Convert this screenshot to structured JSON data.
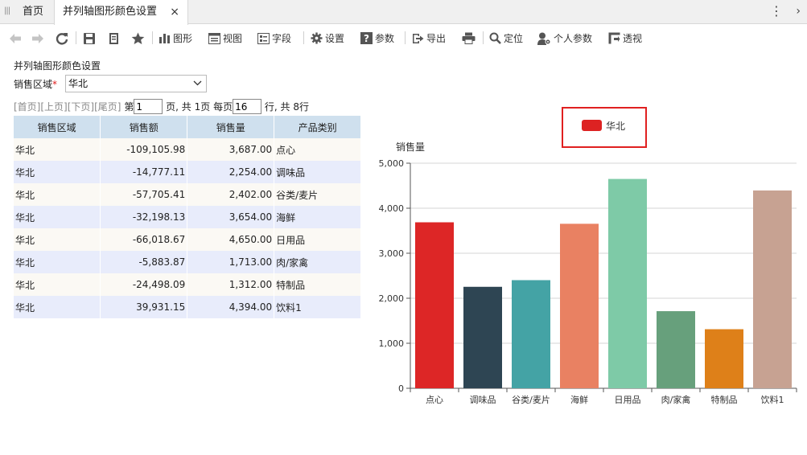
{
  "tabs": {
    "home_label": "首页",
    "active_label": "并列轴图形颜色设置",
    "close_glyph": "×",
    "more_glyph": "⋮",
    "next_glyph": "›"
  },
  "toolbar": {
    "chart_label": "图形",
    "view_label": "视图",
    "field_label": "字段",
    "settings_label": "设置",
    "params_label": "参数",
    "export_label": "导出",
    "locate_label": "定位",
    "personal_params_label": "个人参数",
    "pivot_label": "透视"
  },
  "form": {
    "title": "并列轴图形颜色设置",
    "region_label": "销售区域",
    "required_mark": "*",
    "region_value": "华北"
  },
  "pager": {
    "first": "[首页]",
    "prev": "[上页]",
    "next": "[下页]",
    "last": "[尾页]",
    "page_prefix": "第",
    "page_value": "1",
    "page_suffix": "页, 共 1页 每页",
    "per_page_value": "16",
    "rows_suffix": "行, 共 8行"
  },
  "table": {
    "headers": [
      "销售区域",
      "销售额",
      "销售量",
      "产品类别"
    ],
    "rows": [
      [
        "华北",
        "-109,105.98",
        "3,687.00",
        "点心"
      ],
      [
        "华北",
        "-14,777.11",
        "2,254.00",
        "调味品"
      ],
      [
        "华北",
        "-57,705.41",
        "2,402.00",
        "谷类/麦片"
      ],
      [
        "华北",
        "-32,198.13",
        "3,654.00",
        "海鲜"
      ],
      [
        "华北",
        "-66,018.67",
        "4,650.00",
        "日用品"
      ],
      [
        "华北",
        "-5,883.87",
        "1,713.00",
        "肉/家禽"
      ],
      [
        "华北",
        "-24,498.09",
        "1,312.00",
        "特制品"
      ],
      [
        "华北",
        "39,931.15",
        "4,394.00",
        "饮料1"
      ]
    ]
  },
  "chart_data": {
    "type": "bar",
    "ylabel": "销售量",
    "ylim": [
      0,
      5000
    ],
    "yticks": [
      "0",
      "1,000",
      "2,000",
      "3,000",
      "4,000",
      "5,000"
    ],
    "ytick_values": [
      0,
      1000,
      2000,
      3000,
      4000,
      5000
    ],
    "categories": [
      "点心",
      "调味品",
      "谷类/麦片",
      "海鲜",
      "日用品",
      "肉/家禽",
      "特制品",
      "饮料1"
    ],
    "values": [
      3687,
      2254,
      2402,
      3654,
      4650,
      1713,
      1312,
      4394
    ],
    "colors": [
      "#dd2626",
      "#2e4553",
      "#44a3a5",
      "#e98162",
      "#7ecaa7",
      "#67a07c",
      "#de8019",
      "#c7a292"
    ],
    "legend": [
      {
        "name": "华北",
        "color": "#dd2222"
      }
    ],
    "legend_position": "top-right",
    "grid": true
  }
}
